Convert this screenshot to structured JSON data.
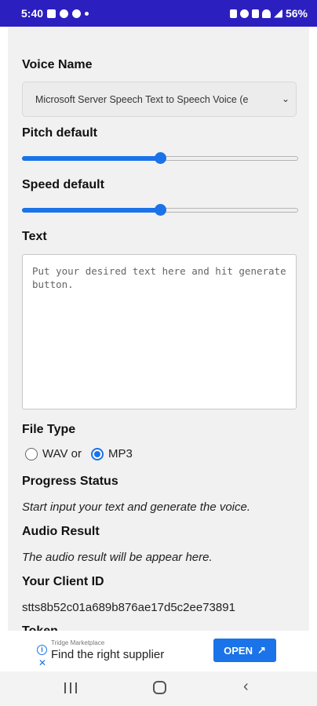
{
  "status_bar": {
    "time": "5:40",
    "battery": "56%"
  },
  "form": {
    "voice_name_label": "Voice Name",
    "voice_select_value": "Microsoft Server Speech Text to Speech Voice (e",
    "pitch_label": "Pitch default",
    "pitch_level": 0.5,
    "speed_label": "Speed default",
    "speed_level": 0.5,
    "text_label": "Text",
    "text_placeholder": "Put your desired text here and hit generate button.",
    "file_type_label": "File Type",
    "file_type_options": [
      {
        "label": "WAV or",
        "selected": false
      },
      {
        "label": "MP3",
        "selected": true
      }
    ],
    "progress_label": "Progress Status",
    "progress_text": "Start input your text and generate the voice.",
    "audio_label": "Audio Result",
    "audio_text": "The audio result will be appear here.",
    "client_id_label": "Your Client ID",
    "client_id_value": "stts8b52c01a689b876ae17d5c2ee73891",
    "token_label": "Token"
  },
  "ad": {
    "source": "Tridge Marketplace",
    "title": "Find the right supplier",
    "button_label": "OPEN"
  },
  "colors": {
    "status_bar": "#2c1fbf",
    "accent": "#1a73e8"
  }
}
